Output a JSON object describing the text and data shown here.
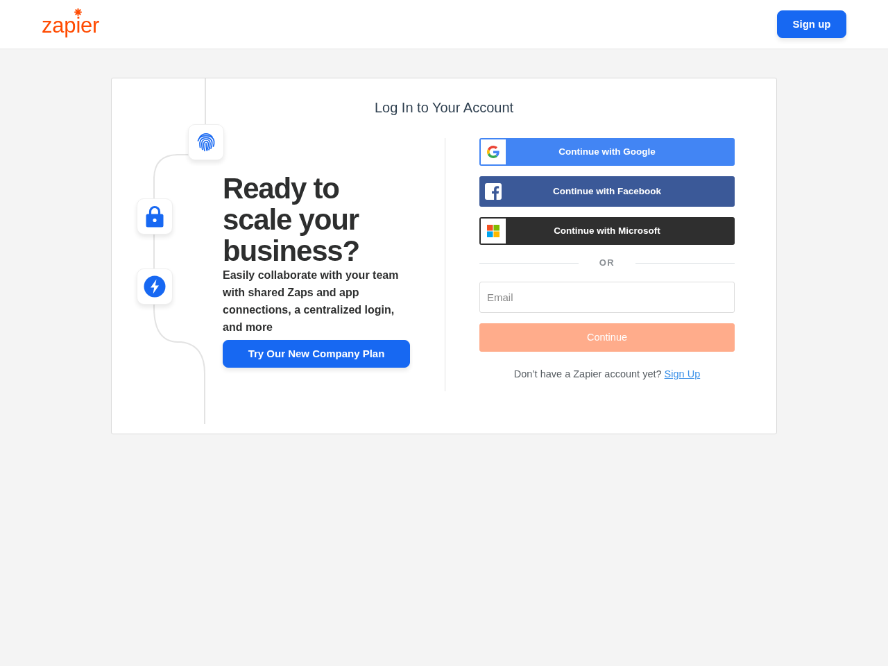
{
  "header": {
    "logo": {
      "text": "zapier"
    },
    "signup_button": {
      "label": "Sign up"
    }
  },
  "card": {
    "title": "Log In to Your Account",
    "promo": {
      "heading": "Ready to scale your business?",
      "text": "Easily collaborate with your team with shared Zaps and app connections, a centralized login, and more",
      "button": {
        "label": "Try Our New Company Plan"
      }
    },
    "social_buttons": [
      {
        "kind": "google",
        "label": "Continue with Google"
      },
      {
        "kind": "facebook",
        "label": "Continue with Facebook"
      },
      {
        "kind": "microsoft",
        "label": "Continue with Microsoft"
      }
    ],
    "divider": {
      "label": "OR"
    },
    "email": {
      "placeholder": "Email"
    },
    "continue_button": {
      "label": "Continue",
      "disabled": true
    },
    "footer": {
      "text": "Don’t have a Zapier account yet?",
      "link": "Sign Up"
    }
  }
}
